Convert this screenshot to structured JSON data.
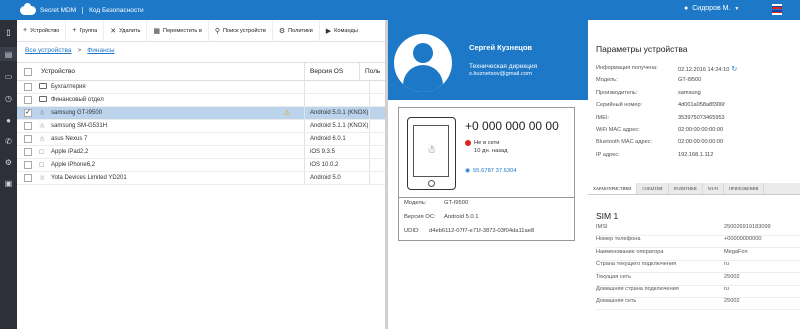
{
  "topbar": {
    "brand": "Secret MDM",
    "subtitle": "Код Безопасности",
    "user": "Сидоров М.",
    "colors": {
      "primary": "#1e78c8",
      "sidebar": "#2d3038"
    }
  },
  "sidebar_icons": [
    "phone-icon",
    "layers-icon",
    "monitor-icon",
    "clock-icon",
    "user-icon",
    "call-icon",
    "gear-icon",
    "chat-icon"
  ],
  "toolbar": {
    "add_device": "Устройство",
    "add_group": "Группа",
    "delete": "Удалить",
    "move": "Переместить в",
    "search": "Поиск устройств",
    "policies": "Политики",
    "commands": "Команды"
  },
  "breadcrumb": {
    "root": "Все устройства",
    "separator": ">",
    "current": "Финансы"
  },
  "grid": {
    "headers": {
      "device": "Устройство",
      "version": "Версия OS",
      "policy": "Поль"
    },
    "rows": [
      {
        "type": "folder",
        "name": "Бухгалтерия",
        "version": ""
      },
      {
        "type": "folder",
        "name": "Финансовый отдел",
        "version": ""
      },
      {
        "type": "android",
        "name": "samsung GT-I9500",
        "version": "Android 5.0.1 (KNOX)",
        "selected": true,
        "warning": true
      },
      {
        "type": "android",
        "name": "samsung SM-G531H",
        "version": "Android 5.1.1 (KNOX)"
      },
      {
        "type": "android",
        "name": "asus Nexus 7",
        "version": "Android 6.0.1"
      },
      {
        "type": "apple",
        "name": "Apple iPad2,2",
        "version": "iOS 9.3.5"
      },
      {
        "type": "apple",
        "name": "Apple iPhone6,2",
        "version": "iOS 10.0.2"
      },
      {
        "type": "android",
        "name": "Yota Devices Limited YD201",
        "version": "Android 5.0"
      }
    ]
  },
  "profile": {
    "name": "Сергей Кузнецов",
    "department": "Техническая дирекция",
    "email": "s.kuznetsov@gmail.com"
  },
  "device_card": {
    "phone": "+0 000 000 00 00",
    "status": "Не в сети",
    "ago": "10 дн. назад",
    "coords": "55.6787 37.6304",
    "model_label": "Модель:",
    "model": "GT-I9500",
    "os_label": "Версия ОС:",
    "os": "Android 5.0.1",
    "udid_label": "UDID:",
    "udid": "d4eb6112-07f7-e71f-3873-03f04da11ae8"
  },
  "params": {
    "title": "Параметры устройства",
    "rows": [
      {
        "label": "Информация получена:",
        "value": "02.12.2016 14:24:10"
      },
      {
        "label": "Модель:",
        "value": "GT-I9500"
      },
      {
        "label": "Производитель:",
        "value": "samsung"
      },
      {
        "label": "Серийный номер:",
        "value": "4d001a058a8f306f"
      },
      {
        "label": "IMEI:",
        "value": "353975073465953"
      },
      {
        "label": "WiFi MAC адрес:",
        "value": "02:00:00:00:00:00"
      },
      {
        "label": "Bluetooth MAC адрес:",
        "value": "02:00:00:00:00:00"
      },
      {
        "label": "IP адрес:",
        "value": "192.168.1.112"
      }
    ],
    "tabs": [
      "Характеристики",
      "События",
      "Политики",
      "Wi-Fi",
      "Приложения"
    ],
    "sim_title": "SIM 1",
    "sim_rows": [
      {
        "label": "IMSI",
        "value": "250026919183099"
      },
      {
        "label": "Номер телефона",
        "value": "+00000000000"
      },
      {
        "label": "Наименование оператора",
        "value": "MegaFon"
      },
      {
        "label": "Страна текущего подключения",
        "value": "ru"
      },
      {
        "label": "Текущая сеть",
        "value": "25002"
      },
      {
        "label": "Домашняя страна подключения",
        "value": "ru"
      },
      {
        "label": "Домашняя сеть",
        "value": "25002"
      }
    ]
  }
}
